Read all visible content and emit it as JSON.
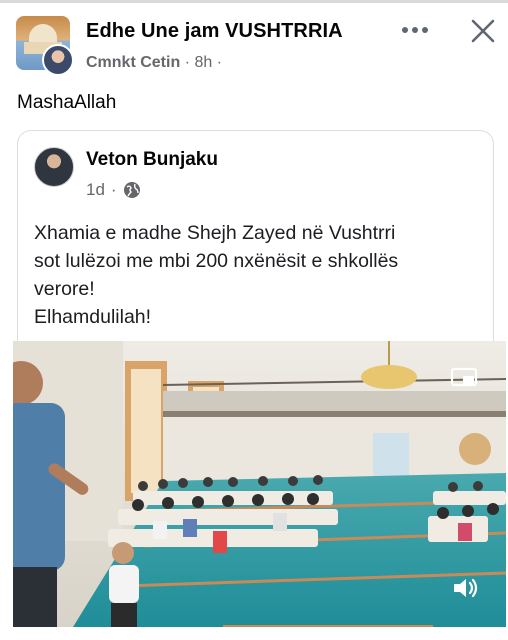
{
  "post": {
    "group_name": "Edhe Une jam VUSHTRRIA",
    "author": "Cmnkt Cetin",
    "time": "8h",
    "separator": "·",
    "text": "MashaAllah"
  },
  "shared_post": {
    "author": "Veton Bunjaku",
    "time": "1d",
    "separator": "·",
    "privacy_icon": "globe-icon",
    "text_lines": [
      "Xhamia e madhe Shejh Zayed në Vushtrri",
      "sot lulëzoi me mbi 200 nxënësit e shkollës",
      "verore!",
      "Elhamdulilah!"
    ]
  },
  "icons": {
    "more": "more-options-icon",
    "close": "close-icon",
    "cast": "cast-icon",
    "volume": "volume-icon"
  },
  "colors": {
    "text_primary": "#050505",
    "text_secondary": "#65676b",
    "card_border": "#dadde1",
    "carpet": "#2f9ea6"
  }
}
